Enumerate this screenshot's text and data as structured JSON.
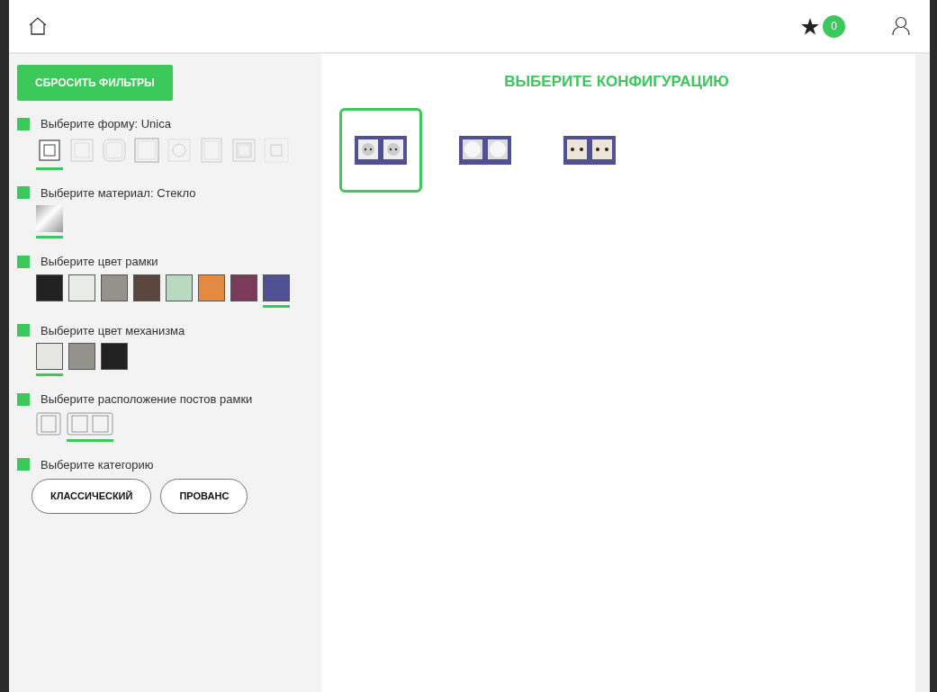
{
  "header": {
    "favorites_count": "0"
  },
  "sidebar": {
    "reset_button": "СБРОСИТЬ ФИЛЬТРЫ",
    "sections": [
      {
        "kind": "shape",
        "label": "Выберите форму: Unica",
        "options": [
          {
            "kind": "square",
            "selected": true
          },
          {
            "kind": "plain",
            "selected": false
          },
          {
            "kind": "rounded",
            "selected": false
          },
          {
            "kind": "thick",
            "selected": false
          },
          {
            "kind": "round",
            "selected": false
          },
          {
            "kind": "tall",
            "selected": false
          },
          {
            "kind": "double",
            "selected": false
          },
          {
            "kind": "small",
            "selected": false
          }
        ]
      },
      {
        "kind": "material",
        "label": "Выберите материал: Стекло",
        "options": [
          {
            "selected": true
          }
        ]
      },
      {
        "kind": "color",
        "label": "Выберите цвет рамки",
        "options": [
          {
            "color": "#222222",
            "selected": false
          },
          {
            "color": "#e8ebe8",
            "selected": false
          },
          {
            "color": "#93938b",
            "selected": false
          },
          {
            "color": "#5a463c",
            "selected": false
          },
          {
            "color": "#b9d9c1",
            "selected": false
          },
          {
            "color": "#e38a40",
            "selected": false
          },
          {
            "color": "#7a3a5a",
            "selected": false
          },
          {
            "color": "#4f5194",
            "selected": true
          }
        ]
      },
      {
        "kind": "color",
        "label": "Выберите цвет механизма",
        "options": [
          {
            "color": "#e6e7e5",
            "selected": true
          },
          {
            "color": "#93938b",
            "selected": false
          },
          {
            "color": "#222222",
            "selected": false
          }
        ]
      },
      {
        "kind": "layout",
        "label": "Выберите расположение постов рамки",
        "options": [
          {
            "kind": "single",
            "selected": false
          },
          {
            "kind": "double",
            "selected": true
          }
        ]
      },
      {
        "kind": "category",
        "label": "Выберите категорию",
        "options": [
          {
            "label": "КЛАССИЧЕСКИЙ"
          },
          {
            "label": "ПРОВАНС"
          }
        ]
      }
    ]
  },
  "main": {
    "title": "ВЫБЕРИТЕ КОНФИГУРАЦИЮ",
    "configurations": [
      {
        "kind": "socket",
        "selected": true
      },
      {
        "kind": "dimmer",
        "selected": false
      },
      {
        "kind": "tv",
        "selected": false
      }
    ]
  }
}
